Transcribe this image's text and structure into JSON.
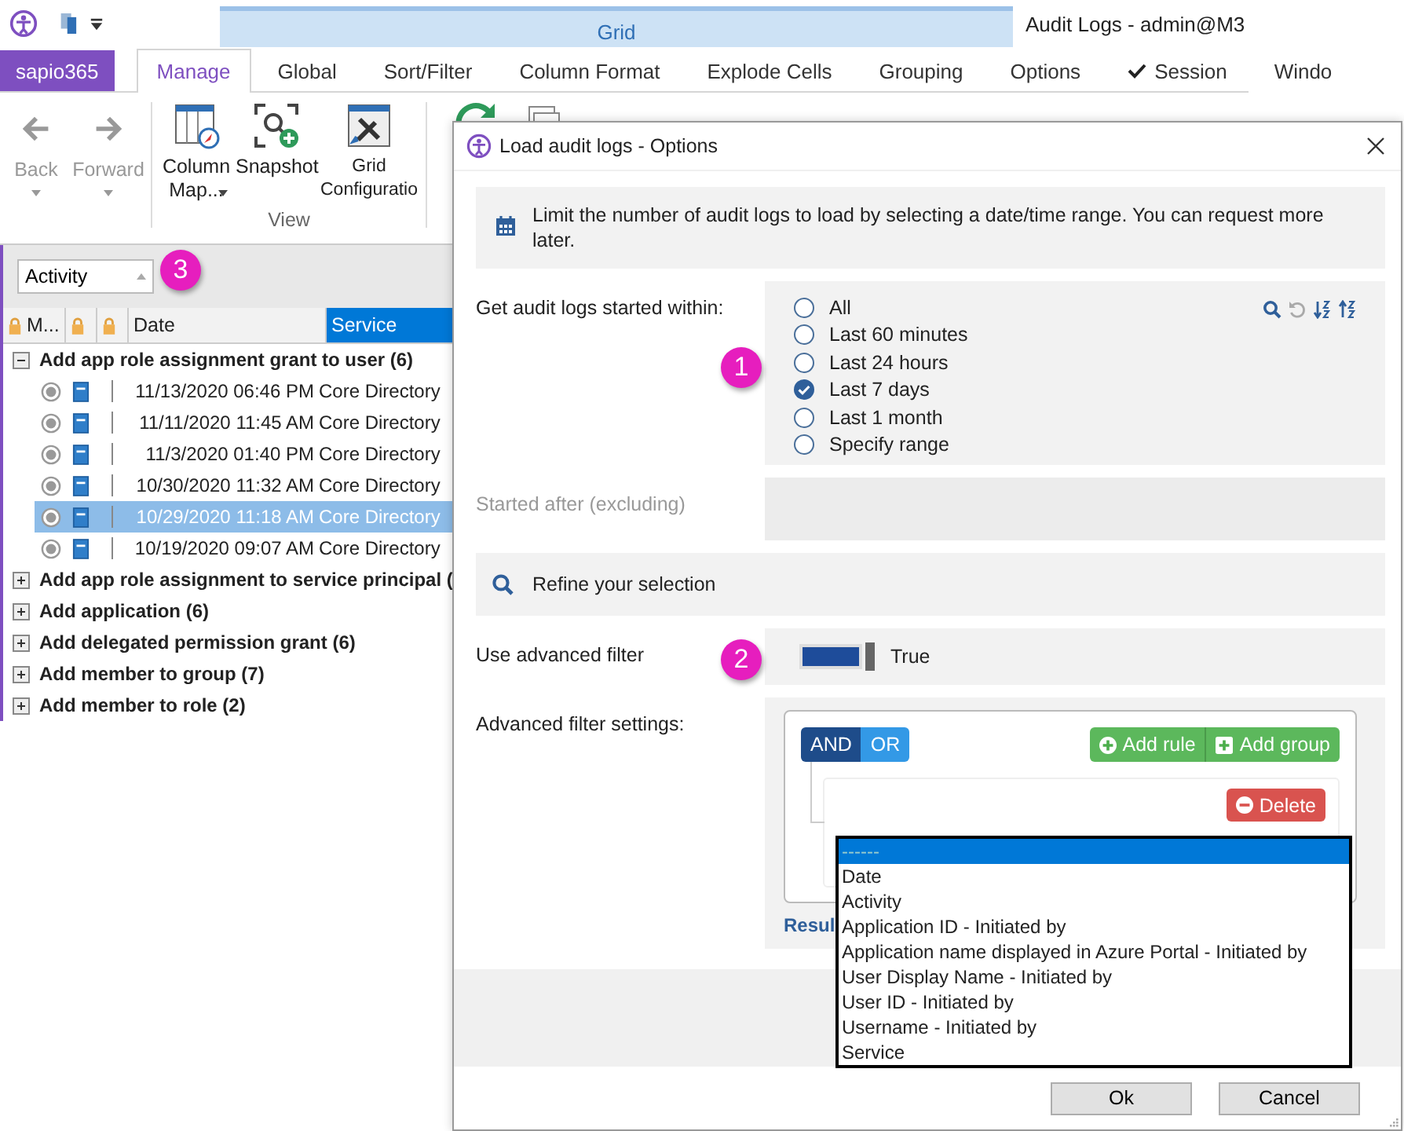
{
  "app": {
    "title": "Audit Logs - admin@M3",
    "contextual_tab": "Grid",
    "app_button": "sapio365",
    "tabs": [
      {
        "label": "Manage",
        "selected": true,
        "checked": false
      },
      {
        "label": "Global",
        "selected": false,
        "checked": false
      },
      {
        "label": "Sort/Filter",
        "selected": false,
        "checked": false
      },
      {
        "label": "Column Format",
        "selected": false,
        "checked": false
      },
      {
        "label": "Explode Cells",
        "selected": false,
        "checked": false
      },
      {
        "label": "Grouping",
        "selected": false,
        "checked": false
      },
      {
        "label": "Options",
        "selected": false,
        "checked": false
      },
      {
        "label": "Session",
        "selected": false,
        "checked": true
      },
      {
        "label": "Windo",
        "selected": false,
        "checked": false
      }
    ],
    "nav_buttons": [
      {
        "label": "Back",
        "kind": "back",
        "disabled": true
      },
      {
        "label": "Forward",
        "kind": "forward",
        "disabled": true
      }
    ],
    "view_group": {
      "label": "View",
      "buttons": [
        {
          "label": "Column Map...",
          "kind": "column-map",
          "dropdown": true
        },
        {
          "label": "Snapshot",
          "kind": "snapshot",
          "dropdown": false
        },
        {
          "label": "Grid Configuratio",
          "kind": "grid-config",
          "dropdown": false
        }
      ]
    }
  },
  "grid": {
    "group_by": "Activity",
    "callout": "3",
    "columns": [
      {
        "kind": "lock-label",
        "label": "M...",
        "selected": false
      },
      {
        "kind": "lock",
        "selected": false
      },
      {
        "kind": "lock",
        "selected": false
      },
      {
        "kind": "text",
        "label": "Date",
        "selected": false
      },
      {
        "kind": "text",
        "label": "Service",
        "selected": true
      }
    ],
    "groups": [
      {
        "label": "Add app role assignment grant to user (6)",
        "expanded": true,
        "rows": [
          {
            "date": "11/13/2020 06:46 PM",
            "service": "Core Directory",
            "selected": false
          },
          {
            "date": "11/11/2020 11:45 AM",
            "service": "Core Directory",
            "selected": false
          },
          {
            "date": "11/3/2020 01:40 PM",
            "service": "Core Directory",
            "selected": false
          },
          {
            "date": "10/30/2020 11:32 AM",
            "service": "Core Directory",
            "selected": false
          },
          {
            "date": "10/29/2020 11:18 AM",
            "service": "Core Directory",
            "selected": true
          },
          {
            "date": "10/19/2020 09:07 AM",
            "service": "Core Directory",
            "selected": false
          }
        ]
      },
      {
        "label": "Add app role assignment to service principal (",
        "expanded": false
      },
      {
        "label": "Add application (6)",
        "expanded": false
      },
      {
        "label": "Add delegated permission grant (6)",
        "expanded": false
      },
      {
        "label": "Add member to group (7)",
        "expanded": false
      },
      {
        "label": "Add member to role (2)",
        "expanded": false
      }
    ]
  },
  "dialog": {
    "title": "Load audit logs - Options",
    "info": "Limit the number of audit logs to load by selecting a date/time range. You can request more later.",
    "range": {
      "label": "Get audit logs started within:",
      "callout": "1",
      "options": [
        {
          "label": "All",
          "selected": false
        },
        {
          "label": "Last 60 minutes",
          "selected": false
        },
        {
          "label": "Last 24 hours",
          "selected": false
        },
        {
          "label": "Last 7 days",
          "selected": true
        },
        {
          "label": "Last 1 month",
          "selected": false
        },
        {
          "label": "Specify range",
          "selected": false
        }
      ]
    },
    "started_after": {
      "label": "Started after (excluding)",
      "disabled": true
    },
    "refine": "Refine your selection",
    "advanced_filter": {
      "label": "Use advanced filter",
      "on": true,
      "value": "True",
      "callout": "2"
    },
    "filter_settings": {
      "label": "Advanced filter settings:",
      "conditions": [
        {
          "label": "AND",
          "selected": true
        },
        {
          "label": "OR",
          "selected": false
        }
      ],
      "actions": [
        {
          "label": "Add rule",
          "kind": "circle"
        },
        {
          "label": "Add group",
          "kind": "square"
        }
      ],
      "delete": "Delete",
      "results_link": "Resul",
      "field_list": [
        {
          "label": "------",
          "selected": true
        },
        {
          "label": "Date",
          "selected": false
        },
        {
          "label": "Activity",
          "selected": false
        },
        {
          "label": "Application ID - Initiated by",
          "selected": false
        },
        {
          "label": "Application name displayed in Azure Portal - Initiated by",
          "selected": false
        },
        {
          "label": "User Display Name - Initiated by",
          "selected": false
        },
        {
          "label": "User ID - Initiated by",
          "selected": false
        },
        {
          "label": "Username - Initiated by",
          "selected": false
        },
        {
          "label": "Service",
          "selected": false
        }
      ]
    },
    "buttons": [
      "Ok",
      "Cancel"
    ]
  }
}
